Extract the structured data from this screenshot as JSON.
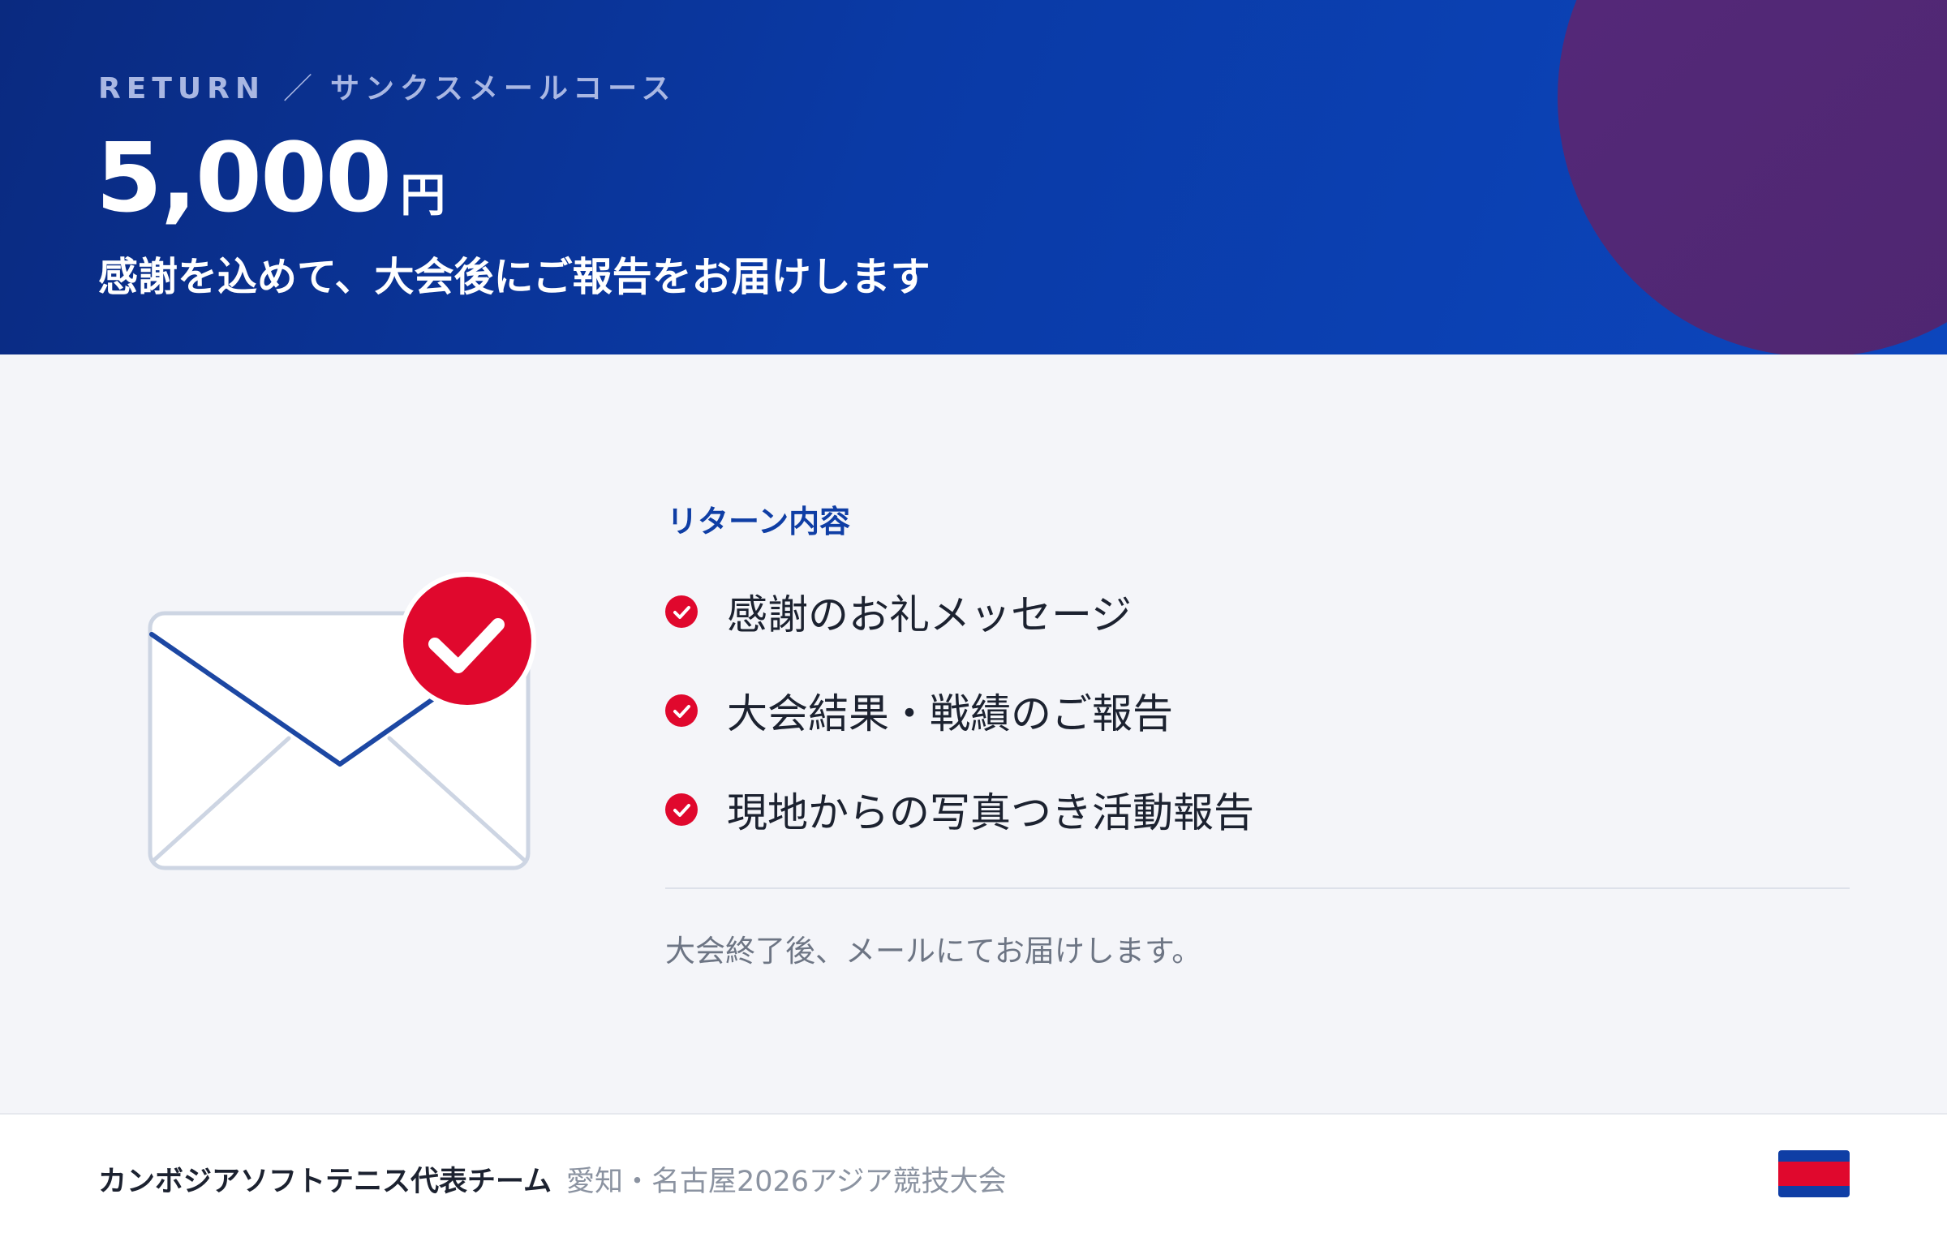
{
  "header": {
    "eyebrow_label": "RETURN",
    "eyebrow_separator": "／",
    "eyebrow_course": "サンクスメールコース",
    "price_amount": "5,000",
    "price_unit": "円",
    "subtitle": "感謝を込めて、大会後にご報告をお届けします"
  },
  "content": {
    "section_label": "リターン内容",
    "items": [
      {
        "label": "感謝のお礼メッセージ"
      },
      {
        "label": "大会結果・戦績のご報告"
      },
      {
        "label": "現地からの写真つき活動報告"
      }
    ],
    "note": "大会終了後、メールにてお届けします。"
  },
  "footer": {
    "team_name": "カンボジアソフトテニス代表チーム",
    "event_name": "愛知・名古屋2026アジア競技大会"
  },
  "icons": {
    "envelope": "envelope-check-icon",
    "item_check": "check-circle-icon",
    "flag": "cambodia-flag-icon"
  },
  "colors": {
    "header_blue": "#0a3aa6",
    "accent_purple": "#4e2670",
    "accent_red": "#e0082d",
    "label_blue": "#0f3ea5",
    "envelope_line": "#1c47a3",
    "envelope_border": "#cdd5e3"
  }
}
